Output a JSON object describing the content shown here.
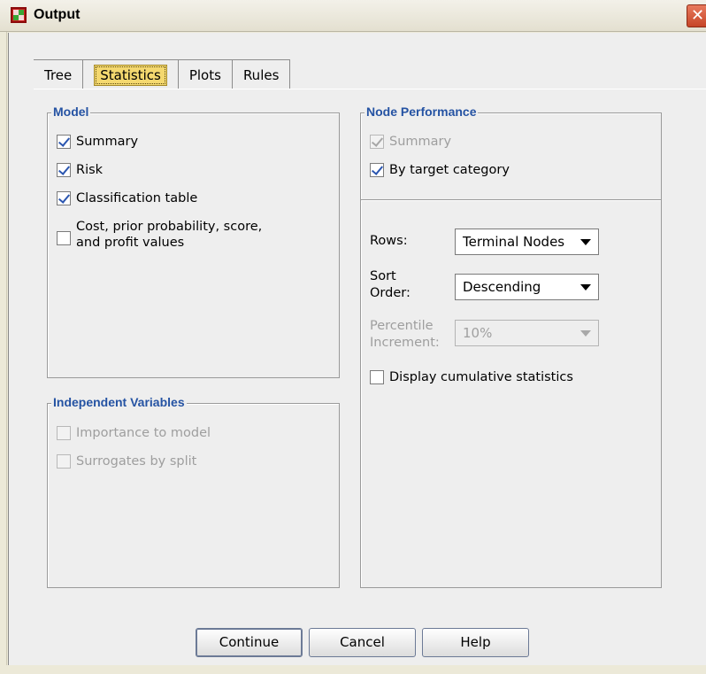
{
  "window": {
    "title": "Output",
    "close_glyph": "✕"
  },
  "tabs": [
    {
      "label": "Tree"
    },
    {
      "label": "Statistics",
      "active": true
    },
    {
      "label": "Plots"
    },
    {
      "label": "Rules"
    }
  ],
  "model": {
    "legend": "Model",
    "summary": {
      "label": "Summary",
      "checked": true
    },
    "risk": {
      "label": "Risk",
      "checked": true
    },
    "classification": {
      "label": "Classification table",
      "checked": true
    },
    "cost": {
      "line1": "Cost, prior probability, score,",
      "line2": "and profit values",
      "checked": false
    }
  },
  "independent": {
    "legend": "Independent Variables",
    "importance": {
      "label": "Importance to model",
      "checked": false,
      "disabled": true
    },
    "surrogates": {
      "label": "Surrogates by split",
      "checked": false,
      "disabled": true
    }
  },
  "node_performance": {
    "legend": "Node Performance",
    "summary": {
      "label": "Summary",
      "checked": true,
      "disabled": true
    },
    "by_target": {
      "label": "By target category",
      "checked": true
    },
    "rows": {
      "label": "Rows:",
      "value": "Terminal Nodes"
    },
    "sort_order": {
      "label_line1": "Sort",
      "label_line2": "Order:",
      "value": "Descending"
    },
    "percentile": {
      "label_line1": "Percentile",
      "label_line2": "Increment:",
      "value": "10%",
      "disabled": true
    },
    "cumulative": {
      "label": "Display cumulative statistics",
      "checked": false
    }
  },
  "buttons": {
    "continue": "Continue",
    "cancel": "Cancel",
    "help": "Help"
  },
  "colors": {
    "legend_blue": "#2553a3",
    "active_tab": "#f4d86f",
    "close_red": "#d0502f"
  },
  "icons": [
    "app-grid-icon",
    "close-icon",
    "chevron-down-icon",
    "checkmark-icon"
  ]
}
